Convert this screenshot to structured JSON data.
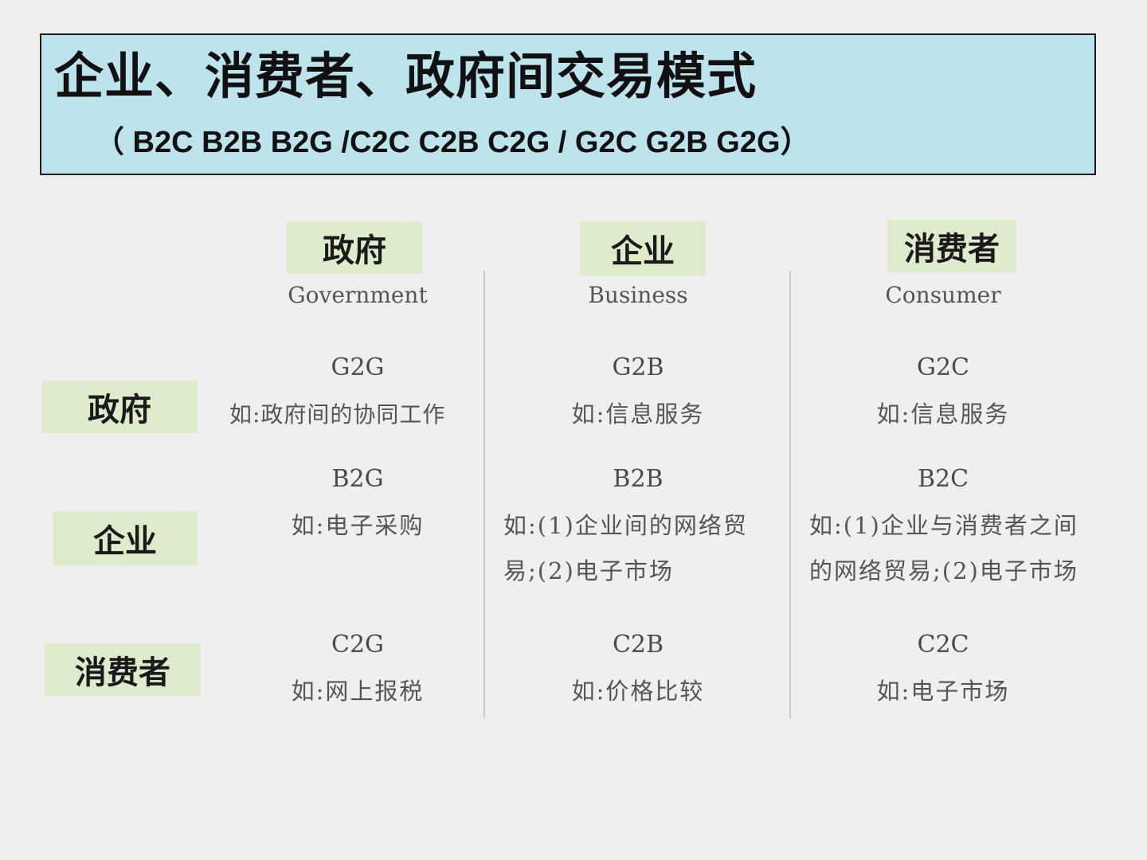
{
  "title": {
    "main": "企业、消费者、政府间交易模式",
    "sub": "（ B2C  B2B  B2G /C2C  C2B C2G / G2C G2B G2G）"
  },
  "columns": [
    {
      "label": "政府",
      "english": "Government"
    },
    {
      "label": "企业",
      "english": "Business"
    },
    {
      "label": "消费者",
      "english": "Consumer"
    }
  ],
  "rows": [
    {
      "label": "政府"
    },
    {
      "label": "企业"
    },
    {
      "label": "消费者"
    }
  ],
  "cells": {
    "g2g": {
      "code": "G2G",
      "example": "如:政府间的协同工作"
    },
    "g2b": {
      "code": "G2B",
      "example": "如:信息服务"
    },
    "g2c": {
      "code": "G2C",
      "example": "如:信息服务"
    },
    "b2g": {
      "code": "B2G",
      "example": "如:电子采购"
    },
    "b2b": {
      "code": "B2B",
      "example": "如:(1)企业间的网络贸易;(2)电子市场"
    },
    "b2c": {
      "code": "B2C",
      "example": "如:(1)企业与消费者之间的网络贸易;(2)电子市场"
    },
    "c2g": {
      "code": "C2G",
      "example": "如:网上报税"
    },
    "c2b": {
      "code": "C2B",
      "example": "如:价格比较"
    },
    "c2c": {
      "code": "C2C",
      "example": "如:电子市场"
    }
  }
}
